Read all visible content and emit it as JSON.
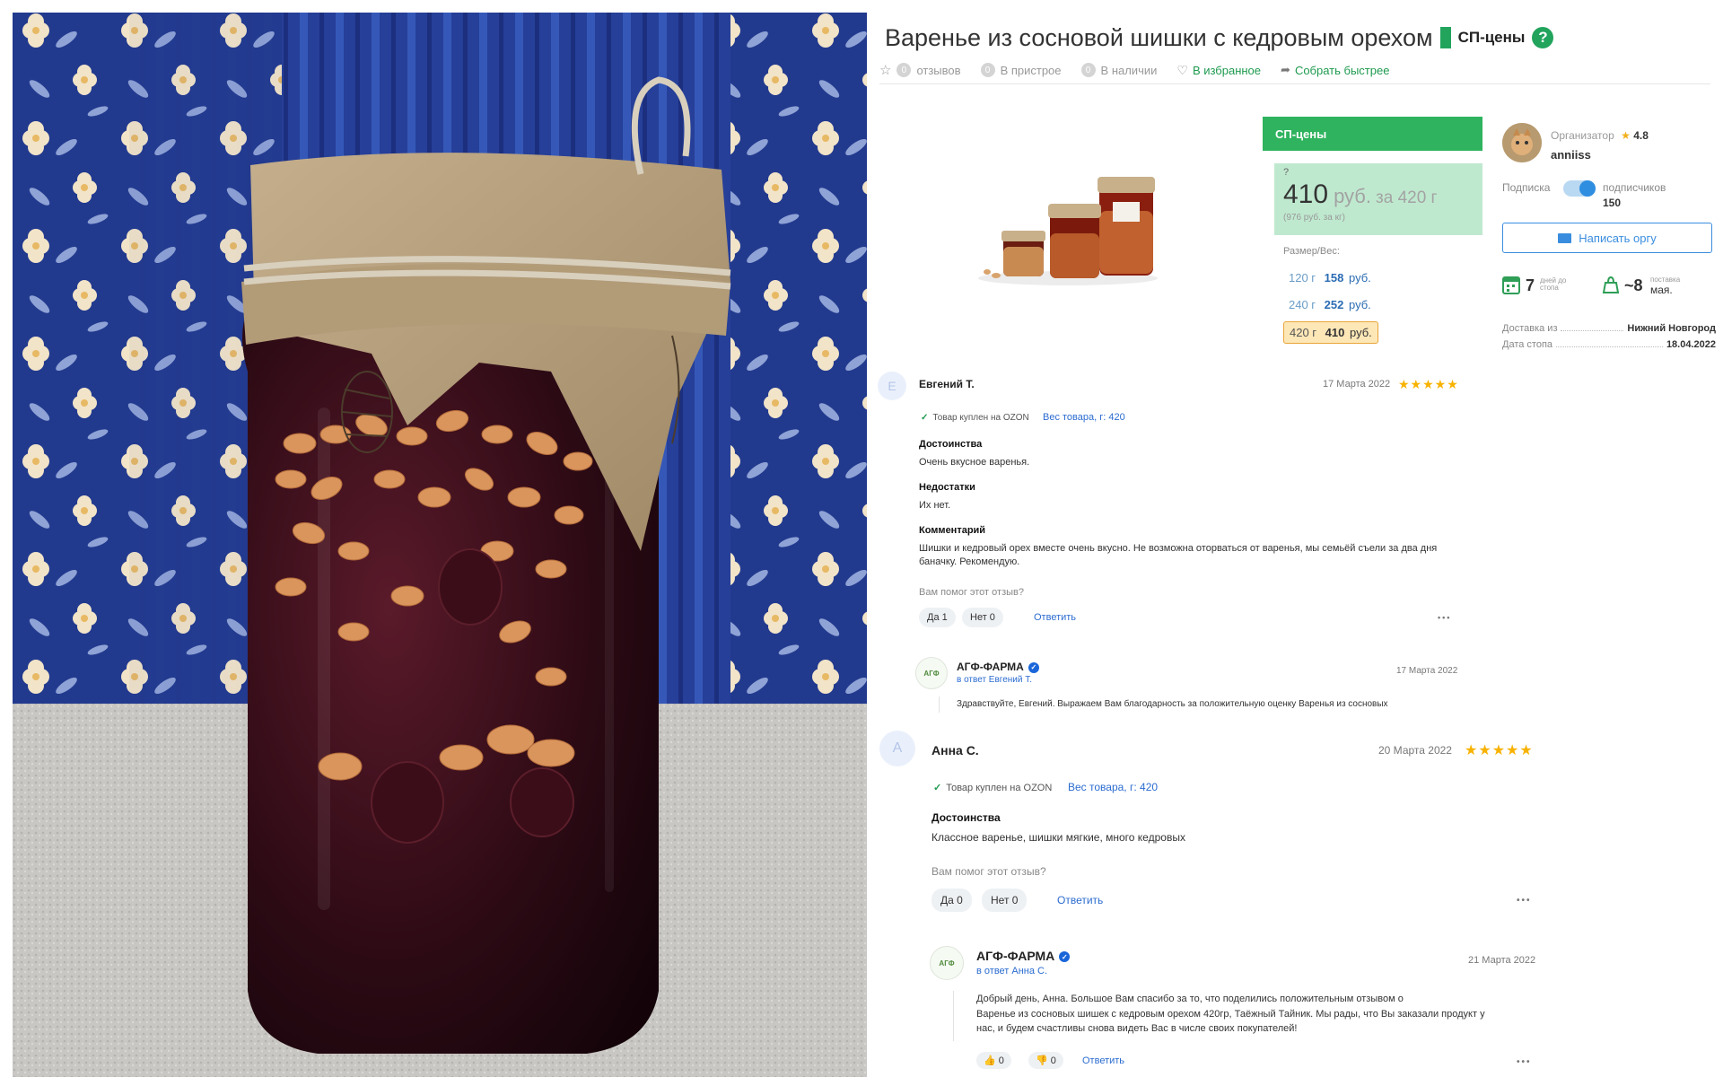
{
  "product": {
    "title": "Варенье из сосновой шишки с кедровым орехом",
    "sp_label": "СП-цены",
    "help_glyph": "?"
  },
  "meta": {
    "reviews_count": "0",
    "reviews_label": "отзывов",
    "attached_count": "0",
    "attached_label": "В пристрое",
    "stock_count": "0",
    "stock_label": "В наличии",
    "favorites_label": "В избранное",
    "collect_label": "Собрать быстрее"
  },
  "price": {
    "header": "СП-цены",
    "help": "?",
    "amount": "410",
    "unit": "руб.",
    "per": "за 420 г",
    "per_kg": "(976 руб. за кг)",
    "size_label": "Размер/Вес:",
    "options": [
      {
        "weight": "120 г",
        "price": "158",
        "currency": "руб.",
        "selected": false
      },
      {
        "weight": "240 г",
        "price": "252",
        "currency": "руб.",
        "selected": false
      },
      {
        "weight": "420 г",
        "price": "410",
        "currency": "руб.",
        "selected": true
      }
    ]
  },
  "organizer": {
    "label": "Организатор",
    "star": "★",
    "rating": "4.8",
    "name": "anniiss",
    "subscription_label": "Подписка",
    "subscribers_label": "подписчиков",
    "subscribers_count": "150",
    "subscribed": true,
    "write_button": "Написать оргу",
    "days_value": "7",
    "days_label_1": "дней до",
    "days_label_2": "стопа",
    "delivery_value": "~8",
    "delivery_label_1": "поставка",
    "delivery_label_2": "мая.",
    "delivery_from_label": "Доставка из",
    "delivery_from_value": "Нижний Новгород",
    "stop_date_label": "Дата стопа",
    "stop_date_value": "18.04.2022"
  },
  "reviews": [
    {
      "avatar_letter": "Е",
      "name": "Евгений Т.",
      "date": "17 Марта 2022",
      "stars": "★★★★★",
      "verified": "Товар куплен на OZON",
      "weight": "Вес товара, г: 420",
      "pros_title": "Достоинства",
      "pros": "Очень вкусное варенья.",
      "cons_title": "Недостатки",
      "cons": "Их нет.",
      "comment_title": "Комментарий",
      "comment_line1": "Шишки и кедровый орех вместе очень вкусно. Не возможна оторваться от варенья, мы семьёй съели за два дня",
      "comment_line2": "баначку. Рекомендую.",
      "helpful_q": "Вам помог этот отзыв?",
      "yes": "Да 1",
      "no": "Нет 0",
      "reply": "Ответить",
      "more": "•••",
      "response": {
        "brand": "АГФ-ФАРМА",
        "logo_text": "АГФ",
        "reply_to": "в ответ Евгений Т.",
        "date": "17 Марта 2022",
        "text": "Здравствуйте, Евгений. Выражаем Вам благодарность за положительную оценку Варенья из сосновых"
      }
    },
    {
      "avatar_letter": "А",
      "name": "Анна С.",
      "date": "20 Марта 2022",
      "stars": "★★★★★",
      "verified": "Товар куплен на OZON",
      "weight": "Вес товара, г: 420",
      "pros_title": "Достоинства",
      "pros": "Классное варенье, шишки мягкие, много кедровых",
      "helpful_q": "Вам помог этот отзыв?",
      "yes": "Да 0",
      "no": "Нет 0",
      "reply": "Ответить",
      "more": "•••",
      "response": {
        "brand": "АГФ-ФАРМА",
        "logo_text": "АГФ",
        "reply_to": "в ответ Анна С.",
        "date": "21 Марта 2022",
        "text_line1": "Добрый день, Анна. Большое Вам спасибо за то, что поделились положительным отзывом о",
        "text_line2": "Варенье из сосновых шишек с кедровым орехом 420гр, Таёжный Тайник. Мы рады, что Вы заказали продукт у",
        "text_line3": "нас, и будем счастливы снова видеть Вас в числе своих покупателей!",
        "likes": "0",
        "dislikes": "0",
        "reply": "Ответить",
        "more": "•••"
      }
    }
  ]
}
